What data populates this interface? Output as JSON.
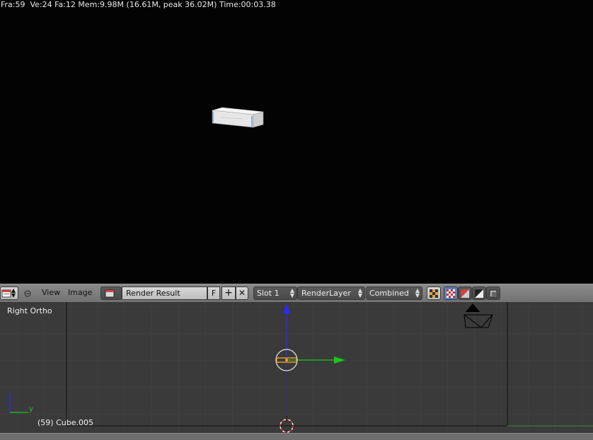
{
  "render": {
    "stats": "Fra:59  Ve:24 Fa:12 Mem:9.98M (16.61M, peak 36.02M) Time:00:03.38"
  },
  "header": {
    "editor_type_icon": "image-editor-icon",
    "collapse_icon": "collapse-icon",
    "menu_view": "View",
    "menu_image": "Image",
    "image_name": "Render Result",
    "fake_user": "F",
    "slot": "Slot 1",
    "layer": "RenderLayer",
    "pass": "Combined"
  },
  "viewport": {
    "view_name": "Right Ortho",
    "object_info": "(59) Cube.005",
    "axis_y_label": "y"
  },
  "colors": {
    "header_bg": "#7e7e7e",
    "viewport_bg": "#3a3a3a",
    "render_bg": "#030303",
    "axis_blue": "#2a2aff",
    "axis_green": "#19c719",
    "selection_orange": "#f0a030"
  }
}
